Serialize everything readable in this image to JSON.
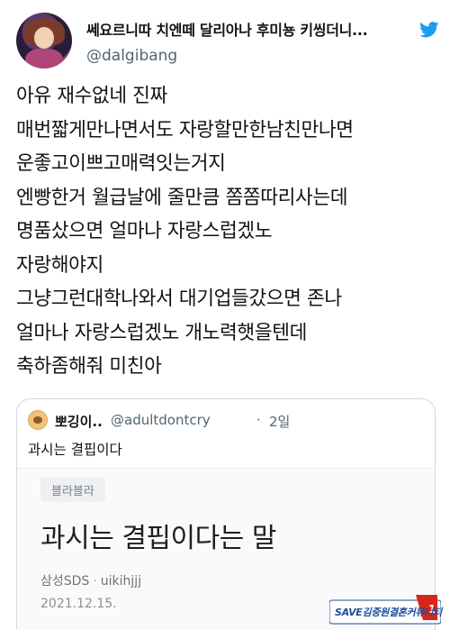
{
  "tweet": {
    "display_name": "쎄요르니따 치엔떼 달리아나 후미뇽 키씽더니...",
    "handle": "@dalgibang",
    "lines": [
      "아유 재수없네 진짜",
      "매번짧게만나면서도 자랑할만한남친만나면",
      "운좋고이쁘고매력잇는거지",
      "엔빵한거 월급날에 줄만큼 쫌쫌따리사는데",
      "명품샀으면 얼마나 자랑스럽겠노",
      "자랑해야지",
      "그냥그런대학나와서 대기업들갔으면 존나",
      "얼마나 자랑스럽겠노 개노력햇을텐데",
      "축하좀해줘 미친아"
    ]
  },
  "quote": {
    "name": "뽀깅이..",
    "handle": "@adultdontcry",
    "dot": "·",
    "time": "2일",
    "text": "과시는 결핍이다",
    "image": {
      "chip": "블라블라",
      "title": "과시는 결핍이다는 말",
      "company": "삼성SDS",
      "sep": "·",
      "user": "uikihjjj",
      "date": "2021.12.15."
    }
  },
  "watermark": {
    "text": "SAVE김중원결혼커뮤니티",
    "colors": {
      "blue": "#1a4fa0",
      "red": "#d9261c"
    }
  },
  "icons": {
    "brand": "twitter-bird-icon"
  },
  "colors": {
    "accent": "#1d9bf0",
    "secondary_text": "#536471",
    "border": "#cfd9de"
  }
}
